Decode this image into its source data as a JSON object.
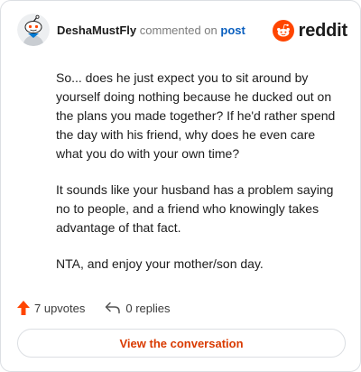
{
  "header": {
    "username": "DeshaMustFly",
    "action_text": "commented on",
    "post_link": "post",
    "brand": "reddit",
    "avatar_icon": "reddit-snoo-avatar-icon",
    "brand_icon": "reddit-logo-icon"
  },
  "comment": {
    "paragraphs": [
      "So... does he just expect you to sit around by yourself doing nothing because he ducked out on the plans you made together? If he'd rather spend the day with his friend, why does he even care what you do with your own time?",
      "It sounds like your husband has a problem saying no to people, and a friend who knowingly takes advantage of that fact.",
      "NTA, and enjoy your mother/son day."
    ]
  },
  "actions": {
    "upvotes": "7 upvotes",
    "replies": "0 replies",
    "upvote_icon": "upvote-arrow-icon",
    "reply_icon": "reply-arrow-icon"
  },
  "cta": {
    "label": "View the conversation"
  },
  "colors": {
    "accent": "#d93a00",
    "upvote": "#ff4500",
    "link": "#0a5fbf",
    "border": "#dcdfe3"
  }
}
